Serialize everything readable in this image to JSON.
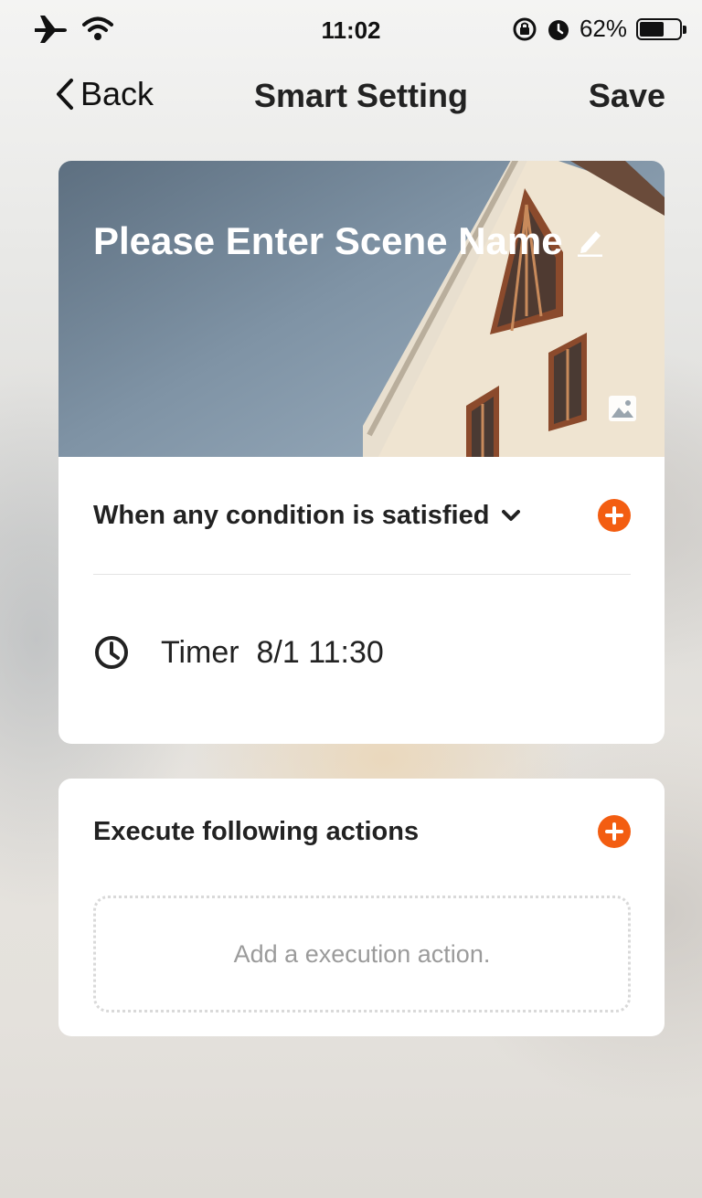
{
  "status_bar": {
    "time": "11:02",
    "battery_percent": "62%",
    "battery_level": 0.62,
    "icons": [
      "airplane-icon",
      "wifi-icon",
      "rotation-lock-icon",
      "alarm-icon",
      "battery-icon"
    ]
  },
  "nav": {
    "back_label": "Back",
    "title": "Smart Setting",
    "save_label": "Save"
  },
  "scene": {
    "name_placeholder": "Please Enter Scene Name",
    "icons": [
      "edit-pencil-icon",
      "change-image-icon"
    ]
  },
  "condition": {
    "label": "When any condition is satisfied",
    "items": [
      {
        "icon": "clock-icon",
        "text": "Timer  8/1 11:30"
      }
    ]
  },
  "actions": {
    "label": "Execute following actions",
    "empty_text": "Add a execution action."
  },
  "colors": {
    "accent": "#f35d11",
    "card_bg": "#ffffff",
    "text_primary": "#222222",
    "text_muted": "#9b9b9b"
  }
}
